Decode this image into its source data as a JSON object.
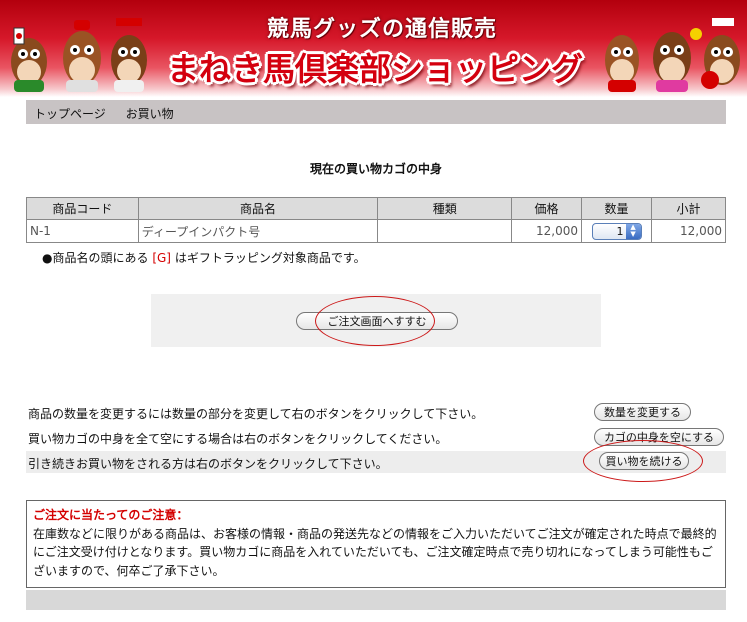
{
  "header": {
    "subtitle": "競馬グッズの通信販売",
    "title": "まねき馬倶楽部ショッピング"
  },
  "breadcrumb": {
    "items": [
      "トップページ",
      "お買い物"
    ]
  },
  "cart": {
    "heading": "現在の買い物カゴの中身",
    "columns": [
      "商品コード",
      "商品名",
      "種類",
      "価格",
      "数量",
      "小計"
    ],
    "rows": [
      {
        "code": "N-1",
        "name": "ディープインパクト号",
        "type": "",
        "price": "12,000",
        "quantity": "1",
        "subtotal": "12,000"
      }
    ]
  },
  "gift_note": {
    "prefix": "●商品名の頭にある",
    "tag": "[G]",
    "suffix": "はギフトラッピング対象商品です。"
  },
  "buttons": {
    "proceed": "ご注文画面へすすむ",
    "update_qty": "数量を変更する",
    "empty_cart": "カゴの中身を空にする",
    "continue": "買い物を続ける"
  },
  "instructions": {
    "update": "商品の数量を変更するには数量の部分を変更して右のボタンをクリックして下さい。",
    "empty": "買い物カゴの中身を全て空にする場合は右のボタンをクリックしてください。",
    "continue": "引き続きお買い物をされる方は右のボタンをクリックして下さい。"
  },
  "notice": {
    "title": "ご注文に当たってのご注意：",
    "body": "在庫数などに限りがある商品は、お客様の情報・商品の発送先などの情報をご入力いただいてご注文が確定された時点で最終的にご注文受け付けとなります。買い物カゴに商品を入れていただいても、ご注文確定時点で売り切れになってしまう可能性もございますので、何卒ご了承下さい。"
  },
  "colors": {
    "brand_red": "#d4000f",
    "annotation_red": "#cc1a1a",
    "breadcrumb_bg": "#c8c3c4"
  }
}
